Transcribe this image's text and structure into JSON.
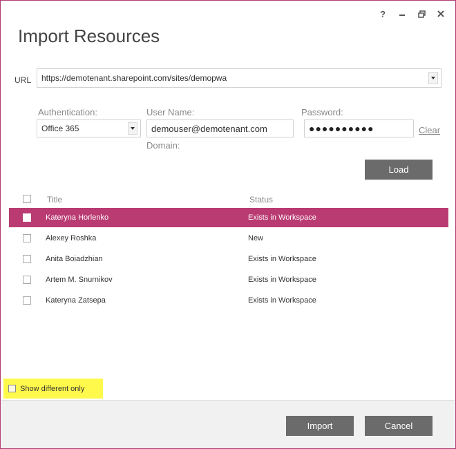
{
  "window": {
    "title": "Import Resources",
    "controls": [
      "help-icon",
      "minimize-icon",
      "restore-icon",
      "close-icon"
    ],
    "help_glyph": "?",
    "accent_color": "#b93b72"
  },
  "url": {
    "label": "URL",
    "value": "https://demotenant.sharepoint.com/sites/demopwa"
  },
  "auth": {
    "auth_label": "Authentication:",
    "auth_value": "Office 365",
    "username_label": "User Name:",
    "username_value": "demouser@demotenant.com",
    "domain_label": "Domain:",
    "password_label": "Password:",
    "password_value": "●●●●●●●●●●",
    "clear_label": "Clear",
    "load_label": "Load"
  },
  "grid": {
    "columns": [
      "Title",
      "Status"
    ],
    "rows": [
      {
        "title": "Kateryna Horlenko",
        "status": "Exists in Workspace",
        "selected": true
      },
      {
        "title": "Alexey Roshka",
        "status": "New",
        "selected": false
      },
      {
        "title": "Anita Boiadzhian",
        "status": "Exists in Workspace",
        "selected": false
      },
      {
        "title": "Artem M. Snurnikov",
        "status": "Exists in Workspace",
        "selected": false
      },
      {
        "title": "Kateryna Zatsepa",
        "status": "Exists in Workspace",
        "selected": false
      }
    ]
  },
  "footer": {
    "show_different_label": "Show different only",
    "import_label": "Import",
    "cancel_label": "Cancel"
  }
}
